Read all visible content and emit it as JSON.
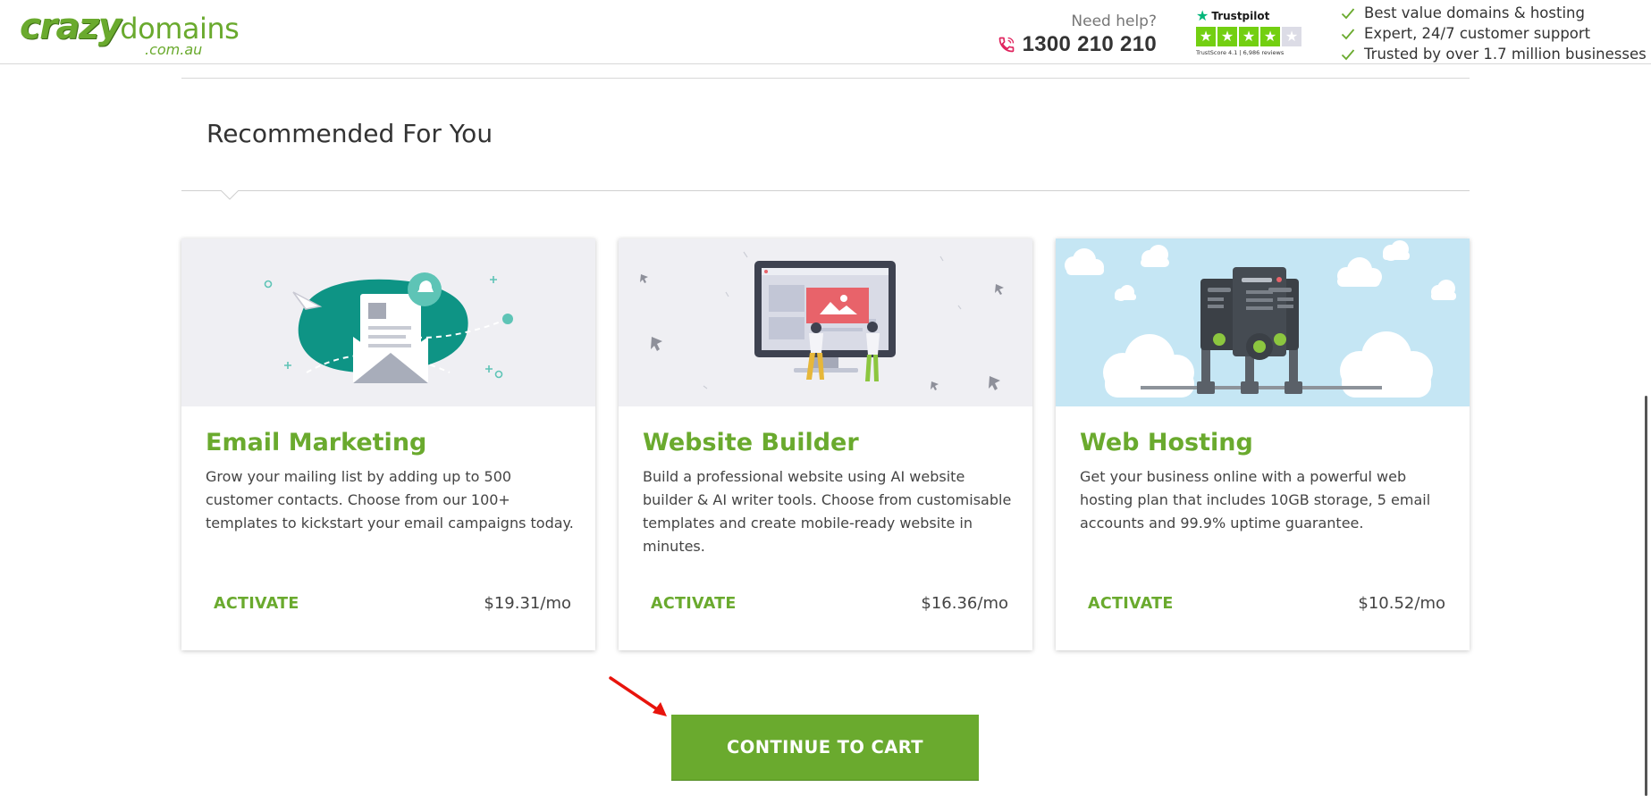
{
  "header": {
    "logo": {
      "main": "crazy",
      "second": "domains",
      "sub": ".com.au"
    },
    "help": {
      "label": "Need help?",
      "phone": "1300 210 210"
    },
    "trustpilot": {
      "brand": "Trustpilot",
      "score_text": "TrustScore 4.1 | 6,986 reviews",
      "rating_stars": 4,
      "max_stars": 5
    },
    "benefits": [
      "Best value domains & hosting",
      "Expert, 24/7 customer support",
      "Trusted by over 1.7 million businesses"
    ]
  },
  "section": {
    "title": "Recommended For You"
  },
  "cards": [
    {
      "title": "Email Marketing",
      "description": "Grow your mailing list by adding up to 500 customer contacts. Choose from our 100+ templates to kickstart your email campaigns today.",
      "action": "ACTIVATE",
      "price": "$19.31/mo",
      "illustration": "email-marketing-illustration"
    },
    {
      "title": "Website Builder",
      "description": "Build a professional website using AI website builder & AI writer tools. Choose from customisable templates and create mobile-ready website in minutes.",
      "action": "ACTIVATE",
      "price": "$16.36/mo",
      "illustration": "website-builder-illustration"
    },
    {
      "title": "Web Hosting",
      "description": "Get your business online with a powerful web hosting plan that includes 10GB storage, 5 email accounts and 99.9% uptime guarantee.",
      "action": "ACTIVATE",
      "price": "$10.52/mo",
      "illustration": "web-hosting-illustration"
    }
  ],
  "cta": {
    "label": "CONTINUE TO CART"
  },
  "colors": {
    "brand_green": "#6aaa2e",
    "teal": "#0e9485",
    "trustpilot_green": "#73cf11",
    "arrow_red": "#e8140c"
  }
}
